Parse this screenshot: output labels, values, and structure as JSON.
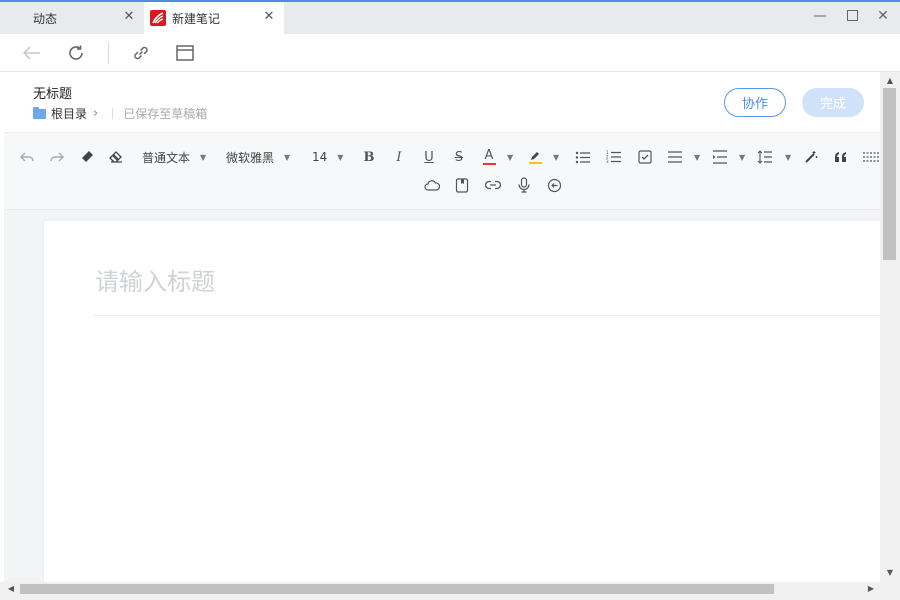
{
  "tabs": [
    {
      "label": "动态"
    },
    {
      "label": "新建笔记"
    }
  ],
  "header": {
    "note_title": "无标题",
    "folder": "根目录",
    "saved_status": "已保存至草稿箱",
    "collab_label": "协作",
    "done_label": "完成"
  },
  "toolbar": {
    "style_select": "普通文本",
    "font_select": "微软雅黑",
    "size_select": "14",
    "bold": "B",
    "italic": "I",
    "underline": "U",
    "strike": "S",
    "font_color": "A"
  },
  "editor": {
    "title_placeholder": "请输入标题"
  },
  "colors": {
    "accent": "#4a8fe7",
    "done_button": "#cfe2fa",
    "logo": "#d71920",
    "font_color_underline": "#e53935",
    "highlight_underline": "#f5c518"
  }
}
